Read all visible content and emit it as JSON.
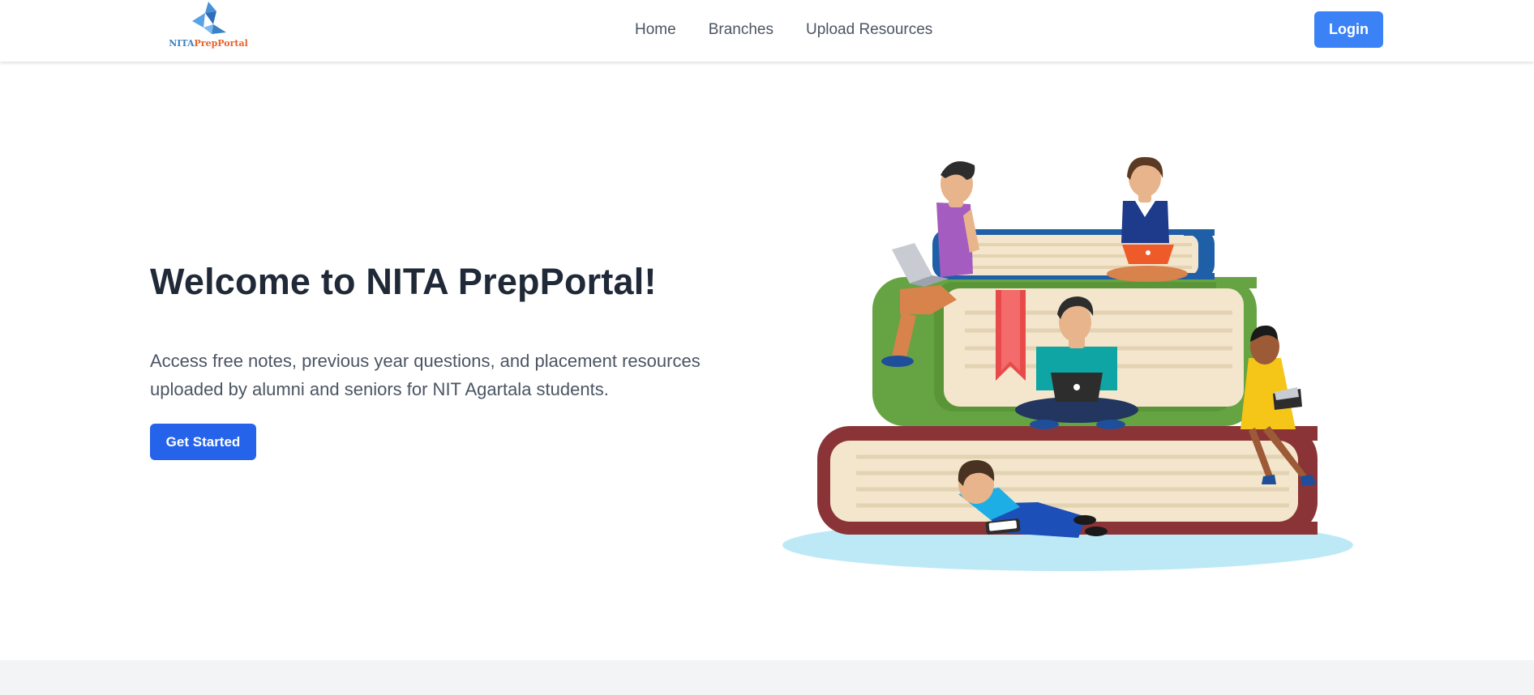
{
  "navbar": {
    "logo": {
      "text_part1": "NITA",
      "text_part2": "PrepPortal",
      "icon": "triangle-logo-icon"
    },
    "links": [
      {
        "label": "Home"
      },
      {
        "label": "Branches"
      },
      {
        "label": "Upload Resources"
      }
    ],
    "login_label": "Login"
  },
  "hero": {
    "title": "Welcome to NITA PrepPortal!",
    "description": "Access free notes, previous year questions, and placement resources uploaded by alumni and seniors for NIT Agartala students.",
    "cta_label": "Get Started",
    "illustration": "students-studying-on-books-illustration"
  },
  "colors": {
    "primary": "#2563eb",
    "login": "#3b82f6",
    "heading": "#1f2937",
    "text": "#4b5563",
    "logo_blue": "#3b82c4",
    "logo_orange": "#e8612c",
    "footer_band": "#f3f4f6"
  }
}
